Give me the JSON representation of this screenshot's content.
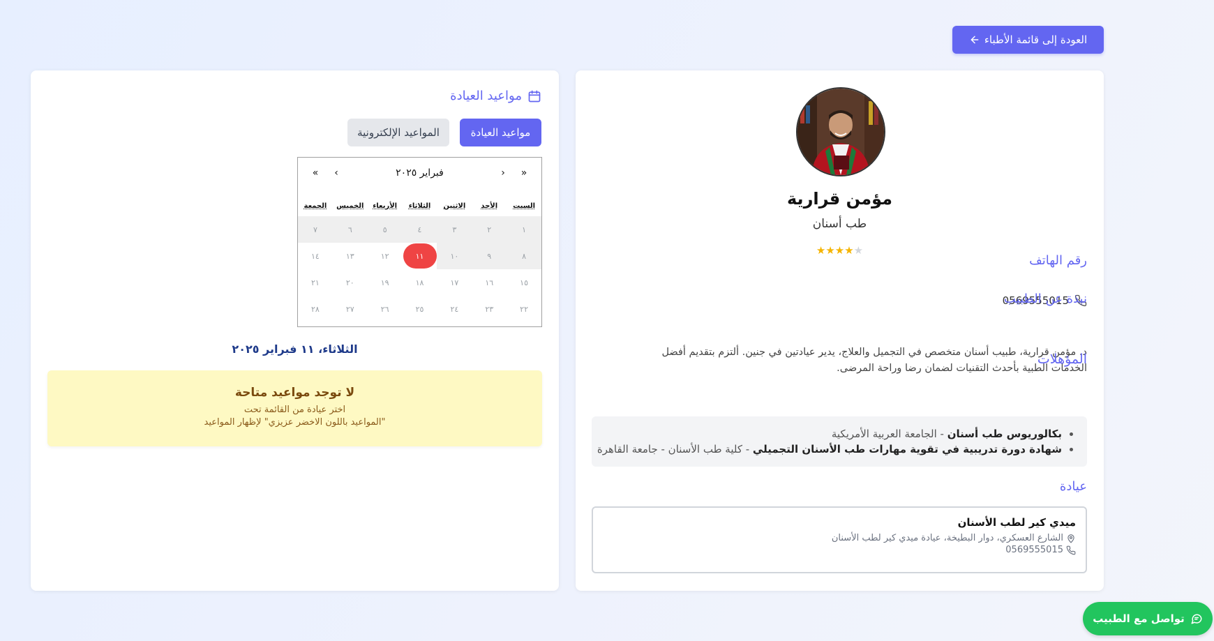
{
  "header": {
    "back_label": "العودة إلى قائمة الأطباء"
  },
  "schedule": {
    "title": "مواعيد العيادة",
    "tabs": [
      {
        "label": "مواعيد العيادة",
        "active": true
      },
      {
        "label": "المواعيد الإلكترونية",
        "active": false
      }
    ],
    "calendar": {
      "month_label": "فبراير ٢٠٢٥",
      "nav": {
        "prev_year": "«",
        "prev_month": "‹",
        "next_month": "›",
        "next_year": "»"
      },
      "weekdays": [
        "السبت",
        "الأحد",
        "الاثنين",
        "الثلاثاء",
        "الأربعاء",
        "الخميس",
        "الجمعة"
      ],
      "weeks": [
        [
          "١",
          "٢",
          "٣",
          "٤",
          "٥",
          "٦",
          "٧"
        ],
        [
          "٨",
          "٩",
          "١٠",
          "١١",
          "١٢",
          "١٣",
          "١٤"
        ],
        [
          "١٥",
          "١٦",
          "١٧",
          "١٨",
          "١٩",
          "٢٠",
          "٢١"
        ],
        [
          "٢٢",
          "٢٣",
          "٢٤",
          "٢٥",
          "٢٦",
          "٢٧",
          "٢٨"
        ]
      ],
      "selected_day": "١١"
    },
    "selected_date_label": "الثلاثاء، ١١ فبراير ٢٠٢٥",
    "notice": {
      "title": "لا توجد مواعيد متاحة",
      "line1": "اختر عيادة من القائمة تحت",
      "line2": "\"المواعيد باللون الاخضر عزيزي\" لإظهار المواعيد"
    }
  },
  "doctor": {
    "name": "مؤمن قرارية",
    "specialty": "طب أسنان",
    "rating": 4,
    "rating_max": 5,
    "phone_title": "رقم الهاتف",
    "phone": "0569555015",
    "bio_title": "نبذة عن الطبيب",
    "bio": "د. مؤمن قرارية، طبيب أسنان متخصص في التجميل والعلاج، يدير عيادتين في جنين. ألتزم بتقديم أفضل الخدمات الطبية بأحدث التقنيات لضمان رضا وراحة المرضى.",
    "qualifications_title": "المؤهلات",
    "qualifications": [
      {
        "title": "بكالوريوس طب أسنان",
        "institution": " - الجامعة العربية الأمريكية"
      },
      {
        "title": "شهادة دورة تدريبية في تقوية مهارات طب الأسنان التجميلي",
        "institution": " - كلية طب الأسنان - جامعة القاهرة"
      }
    ],
    "clinic_title": "عيادة",
    "clinic": {
      "name": "ميدي كير لطب الأسنان",
      "address": "الشارع العسكري، دوار البطيخة، عيادة ميدي كير لطب الأسنان",
      "phone": "0569555015"
    }
  },
  "contact": {
    "label": "تواصل مع الطبيب"
  },
  "colors": {
    "accent": "#6366f1",
    "today": "#ef4444",
    "contact": "#22c55e",
    "notice_bg": "#fef9c3"
  },
  "icons": [
    "arrow-left-icon",
    "calendar-icon",
    "phone-icon",
    "map-pin-icon",
    "chat-icon"
  ]
}
